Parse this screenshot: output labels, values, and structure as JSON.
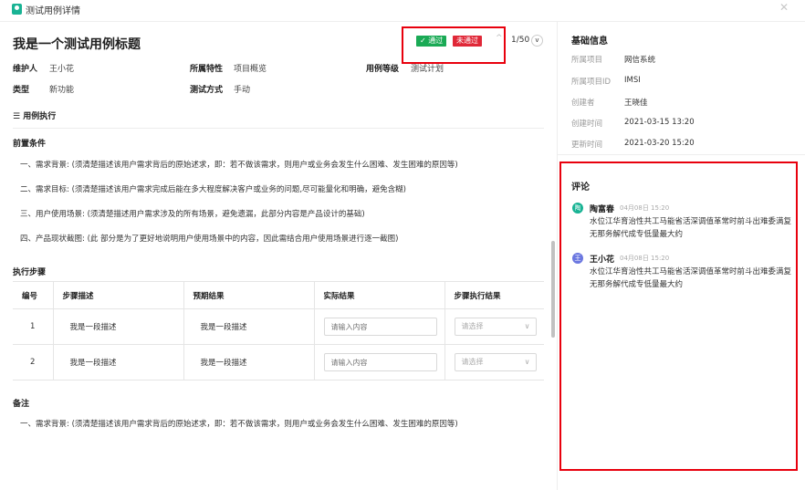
{
  "window": {
    "title": "测试用例详情"
  },
  "header": {
    "case_title": "我是一个测试用例标题",
    "badge_pass": "通过",
    "badge_fail": "未通过",
    "pager_text": "1/50"
  },
  "meta": {
    "maintainer_label": "维护人",
    "maintainer": "王小花",
    "feature_label": "所属特性",
    "feature": "项目概览",
    "level_label": "用例等级",
    "level": "测试计划",
    "type_label": "类型",
    "type": "新功能",
    "method_label": "测试方式",
    "method": "手动"
  },
  "section_link": "用例执行",
  "preconditions": {
    "title": "前置条件",
    "items": [
      "一、需求背景: (须清楚描述该用户需求背后的原始述求，即：若不做该需求，则用户或业务会发生什么困难、发生困难的原因等)",
      "二、需求目标: (须清楚描述该用户需求完成后能在多大程度解决客户或业务的问题,尽可能量化和明确，避免含糊)",
      "三、用户使用场景: (须清楚描述用户需求涉及的所有场景，避免遗漏，此部分内容是产品设计的基础)",
      "四、产品现状截图: (此 部分是为了更好地说明用户使用场景中的内容，因此需结合用户使用场景进行逐一截图)"
    ]
  },
  "steps": {
    "title": "执行步骤",
    "columns": [
      "编号",
      "步骤描述",
      "预期结果",
      "实际结果",
      "步骤执行结果"
    ],
    "rows": [
      {
        "num": "1",
        "desc": "我是一段描述",
        "expected": "我是一段描述"
      },
      {
        "num": "2",
        "desc": "我是一段描述",
        "expected": "我是一段描述"
      }
    ],
    "actual_placeholder": "请输入内容",
    "result_placeholder": "请选择"
  },
  "notes": {
    "title": "备注",
    "text": "一、需求背景: (须清楚描述该用户需求背后的原始述求，即：若不做该需求，则用户或业务会发生什么困难、发生困难的原因等)"
  },
  "sidebar": {
    "basic_title": "基础信息",
    "fields": [
      {
        "k": "所属项目",
        "v": "网信系统"
      },
      {
        "k": "所属项目ID",
        "v": "IMSI"
      },
      {
        "k": "创建者",
        "v": "王晓佳"
      },
      {
        "k": "创建时间",
        "v": "2021-03-15 13:20"
      },
      {
        "k": "更新时间",
        "v": "2021-03-20 15:20"
      }
    ],
    "comments_title": "评论",
    "comments": [
      {
        "avatar": "陶",
        "name": "陶富春",
        "time": "04月08日 15:20",
        "text": "水位江华育治性共工马能省活深调值革常时前斗出难委满复无那务解代成专低量最大约",
        "color": "#19b394"
      },
      {
        "avatar": "王",
        "name": "王小花",
        "time": "04月08日 15:20",
        "text": "水位江华育治性共工马能省活深调值革常时前斗出难委满复无那务解代成专低量最大约",
        "color": "#6b77e0"
      }
    ]
  },
  "colors": {
    "accent": "#19b394",
    "pass": "#1aaa55",
    "fail": "#e02838",
    "highlight": "#e8000d"
  }
}
